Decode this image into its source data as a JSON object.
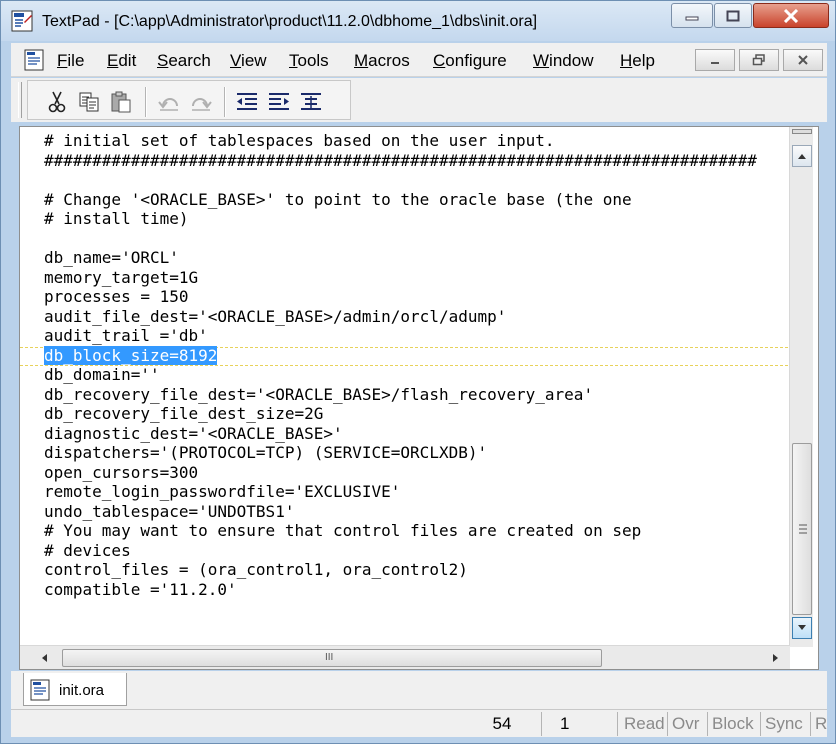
{
  "window": {
    "title": "TextPad - [C:\\app\\Administrator\\product\\11.2.0\\dbhome_1\\dbs\\init.ora]",
    "min_glyph": "—",
    "max_glyph": "☐",
    "close_glyph": "✕"
  },
  "menubar": {
    "items": [
      "File",
      "Edit",
      "Search",
      "View",
      "Tools",
      "Macros",
      "Configure",
      "Window",
      "Help"
    ],
    "mdi_min": "–",
    "mdi_restore": "❐",
    "mdi_close": "✕"
  },
  "toolbar": {
    "icons": [
      "cut-icon",
      "copy-icon",
      "paste-icon",
      "undo-icon",
      "redo-icon",
      "decrease-indent-icon",
      "increase-indent-icon",
      "format-icon"
    ]
  },
  "editor": {
    "lines": [
      "# initial set of tablespaces based on the user input.",
      "##########################################################################",
      "",
      "# Change '<ORACLE_BASE>' to point to the oracle base (the one",
      "# install time)",
      "",
      "db_name='ORCL'",
      "memory_target=1G",
      "processes = 150",
      "audit_file_dest='<ORACLE_BASE>/admin/orcl/adump'",
      "audit_trail ='db'",
      "db_block_size=8192",
      "db_domain=''",
      "db_recovery_file_dest='<ORACLE_BASE>/flash_recovery_area'",
      "db_recovery_file_dest_size=2G",
      "diagnostic_dest='<ORACLE_BASE>'",
      "dispatchers='(PROTOCOL=TCP) (SERVICE=ORCLXDB)'",
      "open_cursors=300",
      "remote_login_passwordfile='EXCLUSIVE'",
      "undo_tablespace='UNDOTBS1'",
      "# You may want to ensure that control files are created on sep",
      "# devices",
      "control_files = (ora_control1, ora_control2)",
      "compatible ='11.2.0'"
    ],
    "selected_line_index": 11,
    "hscroll_grip": "III"
  },
  "tabs": [
    {
      "label": "init.ora"
    }
  ],
  "statusbar": {
    "line": "54",
    "column": "1",
    "read": "Read",
    "ovr": "Ovr",
    "block": "Block",
    "sync": "Sync",
    "rec": "Rec"
  },
  "colors": {
    "selection": "#3399ff",
    "title_bar": "#c4d8ee",
    "close_button": "#c9432c"
  }
}
